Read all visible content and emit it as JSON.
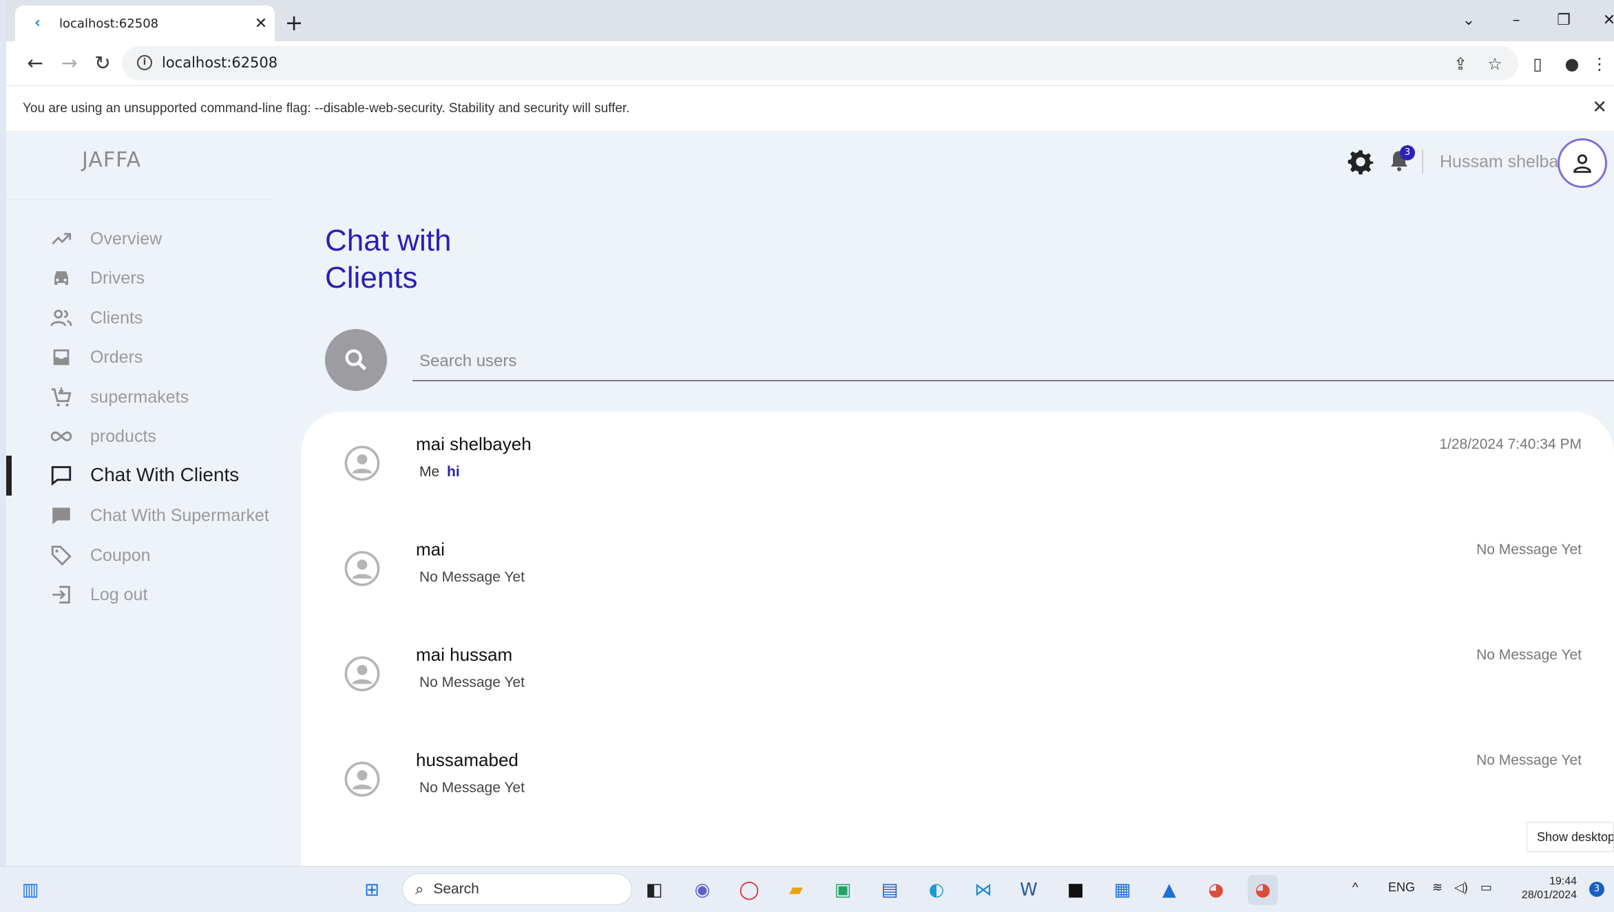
{
  "browser": {
    "tab_title": "localhost:62508",
    "url": "localhost:62508",
    "infobar_message": "You are using an unsupported command-line flag: --disable-web-security. Stability and security will suffer."
  },
  "app": {
    "brand": "JAFFA",
    "nav": [
      {
        "label": "Overview"
      },
      {
        "label": "Drivers"
      },
      {
        "label": "Clients"
      },
      {
        "label": "Orders"
      },
      {
        "label": "supermakets"
      },
      {
        "label": "products"
      },
      {
        "label": "Chat With Clients",
        "active": true
      },
      {
        "label": "Chat With Supermarket"
      },
      {
        "label": "Coupon"
      },
      {
        "label": "Log out"
      }
    ],
    "header": {
      "user_name": "Hussam shelbayeh",
      "notification_count": "3"
    },
    "page_title_line1": "Chat with",
    "page_title_line2": "Clients",
    "search_placeholder": "Search users",
    "chats": [
      {
        "name": "mai shelbayeh",
        "sender": "Me",
        "preview": "hi",
        "time": "1/28/2024 7:40:34 PM"
      },
      {
        "name": "mai",
        "preview": "No Message Yet",
        "time": "No Message Yet"
      },
      {
        "name": "mai hussam",
        "preview": "No Message Yet",
        "time": "No Message Yet"
      },
      {
        "name": "hussamabed",
        "preview": "No Message Yet",
        "time": "No Message Yet"
      }
    ],
    "accent_color": "#2a1fb5"
  },
  "desktop": {
    "tooltip": "Show desktop",
    "taskbar_search": "Search",
    "lang": "ENG",
    "time": "19:44",
    "date": "28/01/2024",
    "notification_count": "3"
  }
}
